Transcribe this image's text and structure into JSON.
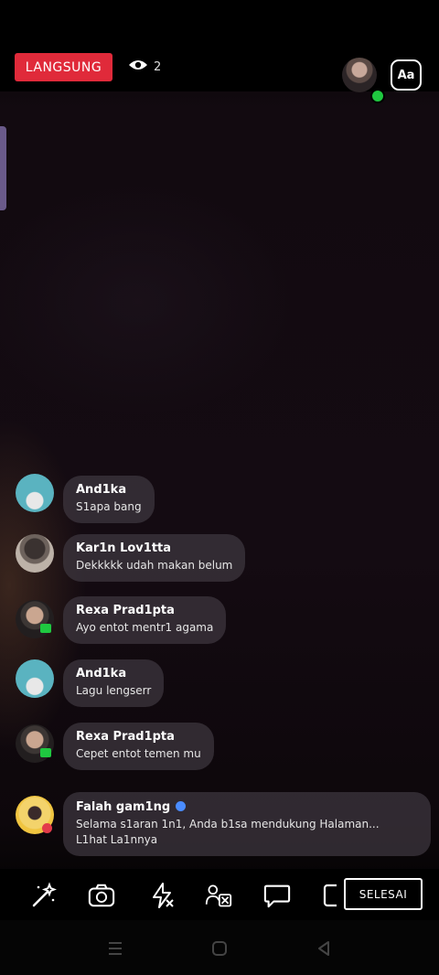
{
  "header": {
    "live_label": "LANGSUNG",
    "viewer_count": "2",
    "text_button_label": "Aa"
  },
  "comments": [
    {
      "name": "And1ka",
      "text": "S1apa bang"
    },
    {
      "name": "Kar1n Lov1tta",
      "text": "Dekkkkk udah makan belum"
    },
    {
      "name": "Rexa Prad1pta",
      "text": "Ayo entot mentr1 agama"
    },
    {
      "name": "And1ka",
      "text": "Lagu lengserr"
    },
    {
      "name": "Rexa Prad1pta",
      "text": "Cepet entot temen mu"
    },
    {
      "name": "Falah gam1ng",
      "text": "Selama s1aran 1n1, Anda b1sa mendukung Halaman...",
      "see_more": "L1hat La1nnya"
    }
  ],
  "toolbar": {
    "icons": [
      "magic-wand-icon",
      "camera-flip-icon",
      "flash-off-icon",
      "guest-off-icon",
      "comment-icon"
    ],
    "done_label": "SELESAI"
  },
  "colors": {
    "live_badge": "#e02a3a",
    "online": "#1fc840",
    "verified": "#4a8cff"
  }
}
